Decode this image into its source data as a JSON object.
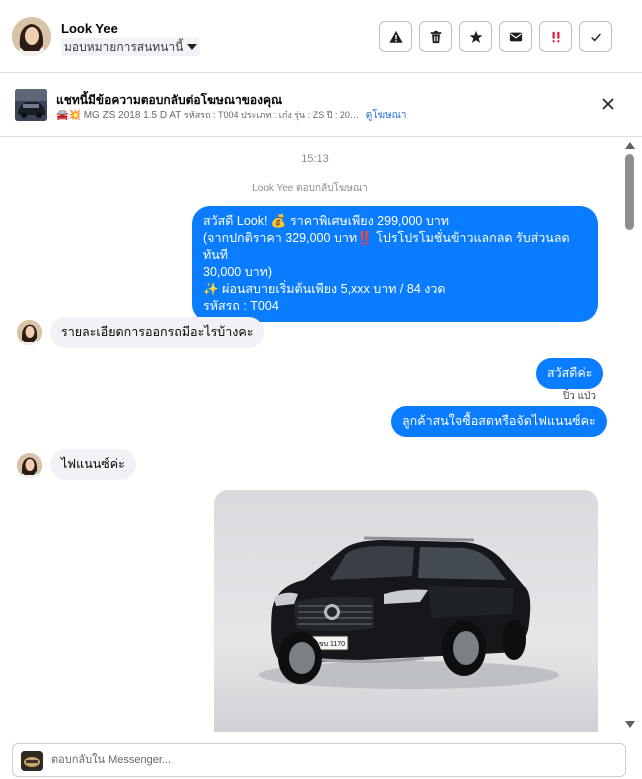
{
  "header": {
    "name": "Look Yee",
    "assign_label": "มอบหมายการสนทนานี้",
    "actions": [
      {
        "icon": "warning-icon"
      },
      {
        "icon": "trash-icon"
      },
      {
        "icon": "star-icon"
      },
      {
        "icon": "envelope-icon"
      },
      {
        "icon": "priority-icon"
      },
      {
        "icon": "check-icon"
      }
    ]
  },
  "ad_banner": {
    "title": "แชทนี้มีข้อความตอบกลับต่อโฆษณาของคุณ",
    "emoji": "🚘💥",
    "subtitle": "MG ZS 2018 1.5 D AT",
    "subtitle_small": "รหัสรถ : T004 ประเภท : เก๋ง รุ่น : ZS ปี : 20…",
    "link": "ดูโฆษณา"
  },
  "thread": {
    "timestamp": "15:13",
    "reply_note": "Look Yee ตอบกลับโฆษณา",
    "messages": [
      {
        "dir": "out",
        "lines": [
          "สวัสดี Look! 💰 ราคาพิเศษเพียง 299,000 บาท",
          "(จากปกติราคา 329,000 บาท‼️ โปรโปรโมชั่นข้าวแลกลด รับส่วนลดทันที",
          "30,000 บาท)",
          "✨ ผ่อนสบายเริ่มต้นเพียง 5,xxx บาท / 84 งวด",
          "รหัสรถ : T004"
        ]
      },
      {
        "dir": "in",
        "text": "รายละเอียดการออกรถมีอะไรบ้างคะ"
      },
      {
        "dir": "out",
        "text": "สวัสดีค่ะ"
      },
      {
        "dir": "out_sender",
        "text": "ปิ๋ว แป่ว"
      },
      {
        "dir": "out",
        "text": "ลูกค้าสนใจซื้อสดหรือจัดไฟแนนซ์คะ"
      },
      {
        "dir": "in",
        "text": "ไฟแนนซ์ค่ะ"
      }
    ],
    "photo": {
      "plate": "1ขบ 1170"
    }
  },
  "composer": {
    "placeholder": "ตอบกลับใน Messenger..."
  },
  "colors": {
    "outgoing_bubble": "#0a7cff",
    "incoming_bubble": "#f0f2f5",
    "link": "#1a6ed8",
    "priority": "#e41e3f"
  }
}
